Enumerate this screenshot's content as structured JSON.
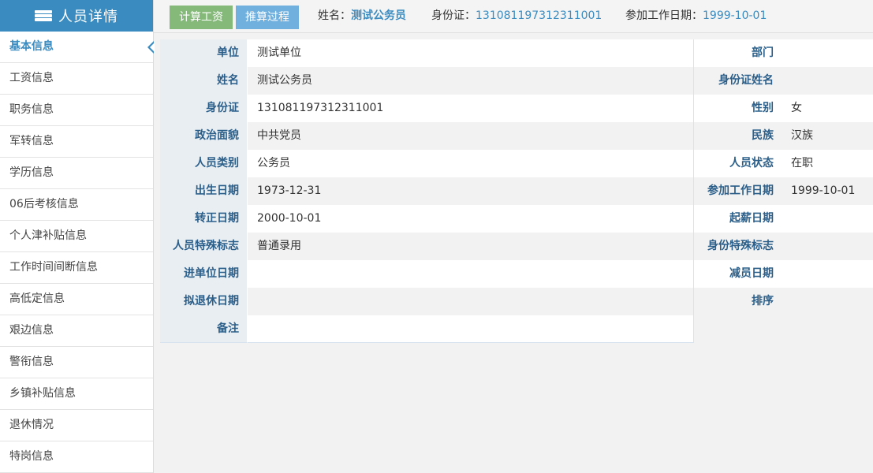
{
  "sidebar": {
    "title": "人员详情",
    "items": [
      {
        "label": "基本信息",
        "active": true
      },
      {
        "label": "工资信息"
      },
      {
        "label": "职务信息"
      },
      {
        "label": "军转信息"
      },
      {
        "label": "学历信息"
      },
      {
        "label": "06后考核信息"
      },
      {
        "label": "个人津补贴信息"
      },
      {
        "label": "工作时间间断信息"
      },
      {
        "label": "高低定信息"
      },
      {
        "label": "艰边信息"
      },
      {
        "label": "警衔信息"
      },
      {
        "label": "乡镇补贴信息"
      },
      {
        "label": "退休情况"
      },
      {
        "label": "特岗信息"
      }
    ]
  },
  "toolbar": {
    "calc_label": "计算工资",
    "derive_label": "推算过程"
  },
  "header_info": {
    "name_label": "姓名：",
    "name_value": "测试公务员",
    "id_label": "身份证：",
    "id_value": "131081197312311001",
    "date_label": "参加工作日期：",
    "date_value": "1999-10-01"
  },
  "colors": {
    "accent": "#3a8bc0",
    "calc_button": "#84b97a",
    "derive_button": "#6fb0df"
  },
  "detail_rows": [
    {
      "l_label": "单位",
      "l_value": "测试单位",
      "r_label": "部门",
      "r_value": ""
    },
    {
      "l_label": "姓名",
      "l_value": "测试公务员",
      "r_label": "身份证姓名",
      "r_value": ""
    },
    {
      "l_label": "身份证",
      "l_value": "131081197312311001",
      "r_label": "性别",
      "r_value": "女"
    },
    {
      "l_label": "政治面貌",
      "l_value": "中共党员",
      "r_label": "民族",
      "r_value": "汉族"
    },
    {
      "l_label": "人员类别",
      "l_value": "公务员",
      "r_label": "人员状态",
      "r_value": "在职"
    },
    {
      "l_label": "出生日期",
      "l_value": "1973-12-31",
      "r_label": "参加工作日期",
      "r_value": "1999-10-01"
    },
    {
      "l_label": "转正日期",
      "l_value": "2000-10-01",
      "r_label": "起薪日期",
      "r_value": ""
    },
    {
      "l_label": "人员特殊标志",
      "l_value": "普通录用",
      "r_label": "身份特殊标志",
      "r_value": ""
    },
    {
      "l_label": "进单位日期",
      "l_value": "",
      "r_label": "减员日期",
      "r_value": ""
    },
    {
      "l_label": "拟退休日期",
      "l_value": "",
      "r_label": "排序",
      "r_value": ""
    },
    {
      "l_label": "备注",
      "l_value": ""
    }
  ]
}
